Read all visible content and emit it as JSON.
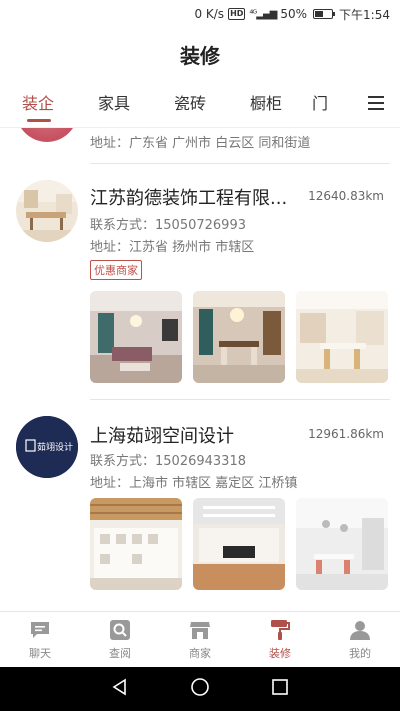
{
  "status": {
    "speed": "0 K/s",
    "hd": "HD",
    "signal": "4G",
    "battery": "50%",
    "battery_level": 0.5,
    "time": "下午1:54"
  },
  "header": {
    "title": "装修"
  },
  "tabs": [
    {
      "label": "装企",
      "active": true
    },
    {
      "label": "家具",
      "active": false
    },
    {
      "label": "瓷砖",
      "active": false
    },
    {
      "label": "橱柜",
      "active": false
    },
    {
      "label": "门",
      "active": false
    }
  ],
  "list": {
    "prev_address": "地址：广东省 广州市 白云区 同和街道",
    "items": [
      {
        "name": "江苏韵德装饰工程有限...",
        "distance": "12640.83km",
        "contact": "联系方式：15050726993",
        "address": "地址：江苏省 扬州市 市辖区",
        "badge": "优惠商家"
      },
      {
        "name": "上海茹翊空间设计",
        "distance": "12961.86km",
        "contact": "联系方式：15026943318",
        "address": "地址：上海市 市辖区 嘉定区 江桥镇",
        "logo_text": "茹翊设计"
      }
    ]
  },
  "bottom_nav": [
    {
      "label": "聊天",
      "icon": "chat-icon",
      "active": false
    },
    {
      "label": "查阅",
      "icon": "search-icon",
      "active": false
    },
    {
      "label": "商家",
      "icon": "store-icon",
      "active": false
    },
    {
      "label": "装修",
      "icon": "paint-roller-icon",
      "active": true
    },
    {
      "label": "我的",
      "icon": "user-icon",
      "active": false
    }
  ],
  "colors": {
    "accent": "#b0504a",
    "text": "#333333",
    "muted": "#777777"
  }
}
